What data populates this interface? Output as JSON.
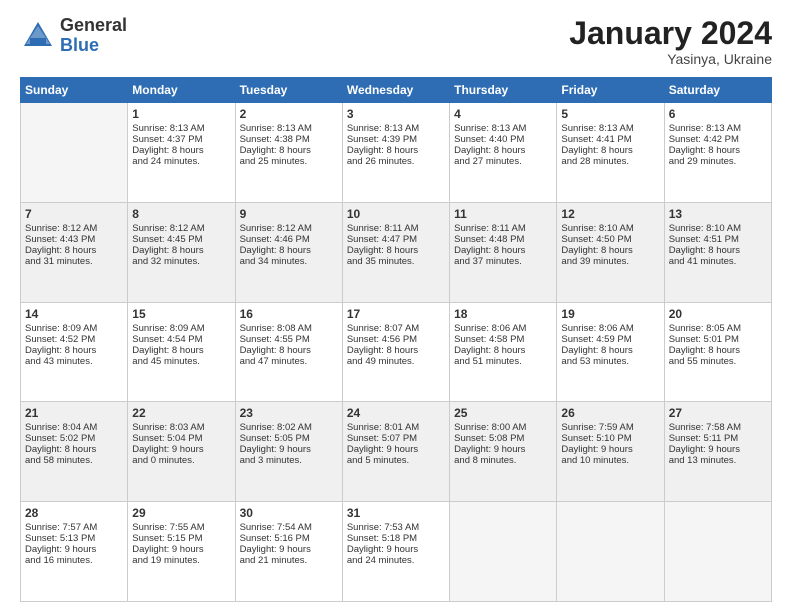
{
  "logo": {
    "general": "General",
    "blue": "Blue"
  },
  "title": "January 2024",
  "location": "Yasinya, Ukraine",
  "days_header": [
    "Sunday",
    "Monday",
    "Tuesday",
    "Wednesday",
    "Thursday",
    "Friday",
    "Saturday"
  ],
  "weeks": [
    [
      {
        "day": "",
        "lines": []
      },
      {
        "day": "1",
        "lines": [
          "Sunrise: 8:13 AM",
          "Sunset: 4:37 PM",
          "Daylight: 8 hours",
          "and 24 minutes."
        ]
      },
      {
        "day": "2",
        "lines": [
          "Sunrise: 8:13 AM",
          "Sunset: 4:38 PM",
          "Daylight: 8 hours",
          "and 25 minutes."
        ]
      },
      {
        "day": "3",
        "lines": [
          "Sunrise: 8:13 AM",
          "Sunset: 4:39 PM",
          "Daylight: 8 hours",
          "and 26 minutes."
        ]
      },
      {
        "day": "4",
        "lines": [
          "Sunrise: 8:13 AM",
          "Sunset: 4:40 PM",
          "Daylight: 8 hours",
          "and 27 minutes."
        ]
      },
      {
        "day": "5",
        "lines": [
          "Sunrise: 8:13 AM",
          "Sunset: 4:41 PM",
          "Daylight: 8 hours",
          "and 28 minutes."
        ]
      },
      {
        "day": "6",
        "lines": [
          "Sunrise: 8:13 AM",
          "Sunset: 4:42 PM",
          "Daylight: 8 hours",
          "and 29 minutes."
        ]
      }
    ],
    [
      {
        "day": "7",
        "lines": [
          "Sunrise: 8:12 AM",
          "Sunset: 4:43 PM",
          "Daylight: 8 hours",
          "and 31 minutes."
        ]
      },
      {
        "day": "8",
        "lines": [
          "Sunrise: 8:12 AM",
          "Sunset: 4:45 PM",
          "Daylight: 8 hours",
          "and 32 minutes."
        ]
      },
      {
        "day": "9",
        "lines": [
          "Sunrise: 8:12 AM",
          "Sunset: 4:46 PM",
          "Daylight: 8 hours",
          "and 34 minutes."
        ]
      },
      {
        "day": "10",
        "lines": [
          "Sunrise: 8:11 AM",
          "Sunset: 4:47 PM",
          "Daylight: 8 hours",
          "and 35 minutes."
        ]
      },
      {
        "day": "11",
        "lines": [
          "Sunrise: 8:11 AM",
          "Sunset: 4:48 PM",
          "Daylight: 8 hours",
          "and 37 minutes."
        ]
      },
      {
        "day": "12",
        "lines": [
          "Sunrise: 8:10 AM",
          "Sunset: 4:50 PM",
          "Daylight: 8 hours",
          "and 39 minutes."
        ]
      },
      {
        "day": "13",
        "lines": [
          "Sunrise: 8:10 AM",
          "Sunset: 4:51 PM",
          "Daylight: 8 hours",
          "and 41 minutes."
        ]
      }
    ],
    [
      {
        "day": "14",
        "lines": [
          "Sunrise: 8:09 AM",
          "Sunset: 4:52 PM",
          "Daylight: 8 hours",
          "and 43 minutes."
        ]
      },
      {
        "day": "15",
        "lines": [
          "Sunrise: 8:09 AM",
          "Sunset: 4:54 PM",
          "Daylight: 8 hours",
          "and 45 minutes."
        ]
      },
      {
        "day": "16",
        "lines": [
          "Sunrise: 8:08 AM",
          "Sunset: 4:55 PM",
          "Daylight: 8 hours",
          "and 47 minutes."
        ]
      },
      {
        "day": "17",
        "lines": [
          "Sunrise: 8:07 AM",
          "Sunset: 4:56 PM",
          "Daylight: 8 hours",
          "and 49 minutes."
        ]
      },
      {
        "day": "18",
        "lines": [
          "Sunrise: 8:06 AM",
          "Sunset: 4:58 PM",
          "Daylight: 8 hours",
          "and 51 minutes."
        ]
      },
      {
        "day": "19",
        "lines": [
          "Sunrise: 8:06 AM",
          "Sunset: 4:59 PM",
          "Daylight: 8 hours",
          "and 53 minutes."
        ]
      },
      {
        "day": "20",
        "lines": [
          "Sunrise: 8:05 AM",
          "Sunset: 5:01 PM",
          "Daylight: 8 hours",
          "and 55 minutes."
        ]
      }
    ],
    [
      {
        "day": "21",
        "lines": [
          "Sunrise: 8:04 AM",
          "Sunset: 5:02 PM",
          "Daylight: 8 hours",
          "and 58 minutes."
        ]
      },
      {
        "day": "22",
        "lines": [
          "Sunrise: 8:03 AM",
          "Sunset: 5:04 PM",
          "Daylight: 9 hours",
          "and 0 minutes."
        ]
      },
      {
        "day": "23",
        "lines": [
          "Sunrise: 8:02 AM",
          "Sunset: 5:05 PM",
          "Daylight: 9 hours",
          "and 3 minutes."
        ]
      },
      {
        "day": "24",
        "lines": [
          "Sunrise: 8:01 AM",
          "Sunset: 5:07 PM",
          "Daylight: 9 hours",
          "and 5 minutes."
        ]
      },
      {
        "day": "25",
        "lines": [
          "Sunrise: 8:00 AM",
          "Sunset: 5:08 PM",
          "Daylight: 9 hours",
          "and 8 minutes."
        ]
      },
      {
        "day": "26",
        "lines": [
          "Sunrise: 7:59 AM",
          "Sunset: 5:10 PM",
          "Daylight: 9 hours",
          "and 10 minutes."
        ]
      },
      {
        "day": "27",
        "lines": [
          "Sunrise: 7:58 AM",
          "Sunset: 5:11 PM",
          "Daylight: 9 hours",
          "and 13 minutes."
        ]
      }
    ],
    [
      {
        "day": "28",
        "lines": [
          "Sunrise: 7:57 AM",
          "Sunset: 5:13 PM",
          "Daylight: 9 hours",
          "and 16 minutes."
        ]
      },
      {
        "day": "29",
        "lines": [
          "Sunrise: 7:55 AM",
          "Sunset: 5:15 PM",
          "Daylight: 9 hours",
          "and 19 minutes."
        ]
      },
      {
        "day": "30",
        "lines": [
          "Sunrise: 7:54 AM",
          "Sunset: 5:16 PM",
          "Daylight: 9 hours",
          "and 21 minutes."
        ]
      },
      {
        "day": "31",
        "lines": [
          "Sunrise: 7:53 AM",
          "Sunset: 5:18 PM",
          "Daylight: 9 hours",
          "and 24 minutes."
        ]
      },
      {
        "day": "",
        "lines": []
      },
      {
        "day": "",
        "lines": []
      },
      {
        "day": "",
        "lines": []
      }
    ]
  ]
}
